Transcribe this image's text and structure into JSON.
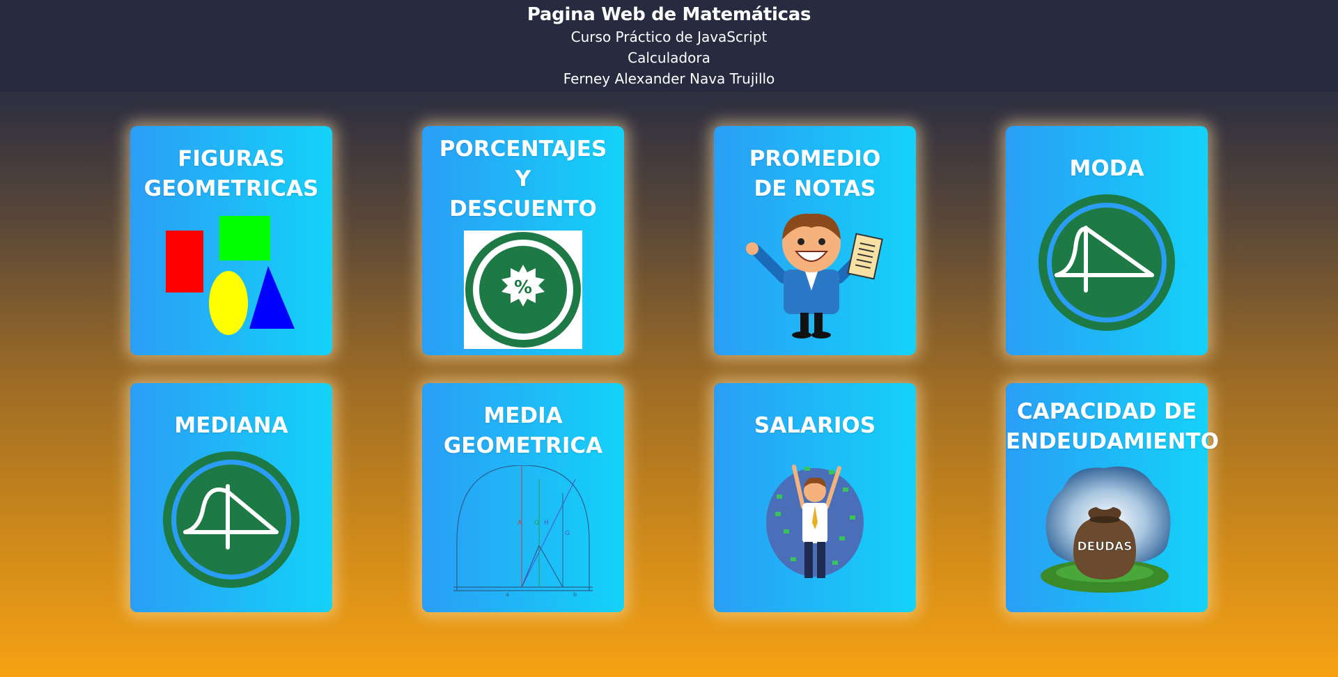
{
  "header": {
    "title": "Pagina Web de Matemáticas",
    "lines": [
      "Curso Práctico de JavaScript",
      "Calculadora",
      "Ferney Alexander Nava Trujillo"
    ]
  },
  "cards": [
    {
      "title_lines": [
        "FIGURAS",
        "GEOMETRICAS"
      ],
      "icon": "geometric-shapes-icon"
    },
    {
      "title_lines": [
        "PORCENTAJES",
        "Y",
        "DESCUENTO"
      ],
      "icon": "percent-badge-icon",
      "icon_text": "%"
    },
    {
      "title_lines": [
        "PROMEDIO",
        "DE NOTAS"
      ],
      "icon": "student-with-grades-icon"
    },
    {
      "title_lines": [
        "MODA"
      ],
      "icon": "moda-distribution-icon"
    },
    {
      "title_lines": [
        "MEDIANA"
      ],
      "icon": "mediana-distribution-icon"
    },
    {
      "title_lines": [
        "MEDIA",
        "GEOMETRICA"
      ],
      "icon": "geometric-mean-diagram-icon",
      "diagram_labels": [
        "A",
        "Q",
        "H",
        "G",
        "a",
        "b"
      ]
    },
    {
      "title_lines": [
        "SALARIOS"
      ],
      "icon": "happy-salary-man-icon"
    },
    {
      "title_lines": [
        "CAPACIDAD DE",
        "ENDEUDAMIENTO"
      ],
      "icon": "debt-bag-icon",
      "icon_text": "DEUDAS"
    }
  ],
  "colors": {
    "header_bg": "#262b40",
    "card_gradient_start": "#2a9ef6",
    "card_gradient_end": "#14d2f8",
    "page_gradient_bottom": "#f6a214",
    "badge_green": "#1e7a45"
  }
}
